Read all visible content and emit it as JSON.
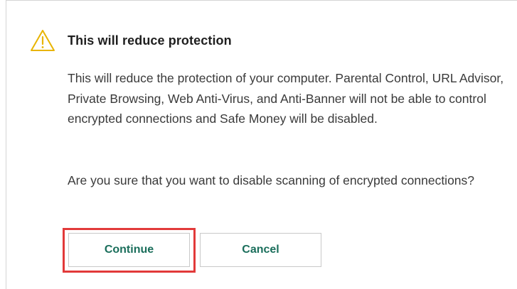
{
  "dialog": {
    "title": "This will reduce protection",
    "icon": "warning-triangle-icon",
    "message": "This will reduce the protection of your computer. Parental Control, URL Advisor, Private Browsing, Web Anti-Virus, and Anti-Banner will not be able to control encrypted connections and Safe Money will be disabled.",
    "question": "Are you sure that you want to disable scanning of encrypted connections?",
    "buttons": {
      "continue_label": "Continue",
      "cancel_label": "Cancel"
    }
  },
  "colors": {
    "button_text": "#1a6e5b",
    "highlight": "#e23a3a",
    "warning_icon": "#e8b400"
  }
}
